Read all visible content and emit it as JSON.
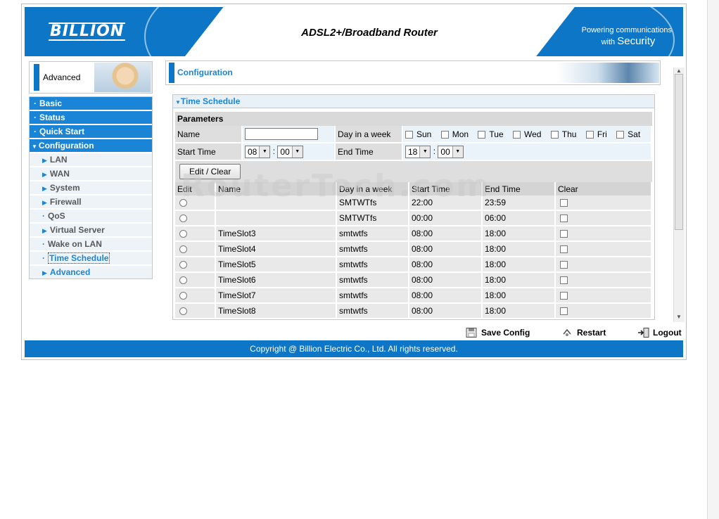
{
  "header": {
    "brand": "BILLION",
    "product": "ADSL2+/Broadband Router",
    "tagline_line1": "Powering communications",
    "tagline_line2_small": "with",
    "tagline_line2_big": "Security"
  },
  "sidebar": {
    "title": "Advanced",
    "sections": [
      {
        "label": "Basic"
      },
      {
        "label": "Status"
      },
      {
        "label": "Quick Start"
      },
      {
        "label": "Configuration"
      }
    ],
    "items": [
      {
        "label": "LAN"
      },
      {
        "label": "WAN"
      },
      {
        "label": "System"
      },
      {
        "label": "Firewall"
      },
      {
        "label": "QoS"
      },
      {
        "label": "Virtual Server"
      },
      {
        "label": "Wake on LAN"
      },
      {
        "label": "Time Schedule"
      },
      {
        "label": "Advanced"
      }
    ]
  },
  "page": {
    "title": "Configuration",
    "section_title": "Time Schedule",
    "parameters_label": "Parameters",
    "name_label": "Name",
    "name_value": "",
    "day_label": "Day in a week",
    "days": [
      "Sun",
      "Mon",
      "Tue",
      "Wed",
      "Thu",
      "Fri",
      "Sat"
    ],
    "start_label": "Start Time",
    "start_hour": "08",
    "start_min": "00",
    "end_label": "End Time",
    "end_hour": "18",
    "end_min": "00",
    "time_sep": ":",
    "edit_clear_button": "Edit / Clear"
  },
  "schedule_table": {
    "headers": [
      "Edit",
      "Name",
      "Day in a week",
      "Start Time",
      "End Time",
      "Clear"
    ],
    "rows": [
      {
        "name": "",
        "days": "SMTWTfs",
        "start": "22:00",
        "end": "23:59"
      },
      {
        "name": "",
        "days": "SMTWTfs",
        "start": "00:00",
        "end": "06:00"
      },
      {
        "name": "TimeSlot3",
        "days": "smtwtfs",
        "start": "08:00",
        "end": "18:00"
      },
      {
        "name": "TimeSlot4",
        "days": "smtwtfs",
        "start": "08:00",
        "end": "18:00"
      },
      {
        "name": "TimeSlot5",
        "days": "smtwtfs",
        "start": "08:00",
        "end": "18:00"
      },
      {
        "name": "TimeSlot6",
        "days": "smtwtfs",
        "start": "08:00",
        "end": "18:00"
      },
      {
        "name": "TimeSlot7",
        "days": "smtwtfs",
        "start": "08:00",
        "end": "18:00"
      },
      {
        "name": "TimeSlot8",
        "days": "smtwtfs",
        "start": "08:00",
        "end": "18:00"
      }
    ]
  },
  "actions": {
    "save": "Save Config",
    "restart": "Restart",
    "logout": "Logout"
  },
  "footer": {
    "copyright": "Copyright @ Billion Electric Co., Ltd. All rights reserved."
  },
  "watermark": "RouterTech.com",
  "colors": {
    "brand_blue": "#0d76c6",
    "menu_blue": "#1a85d6",
    "link_blue": "#1a85d6"
  }
}
